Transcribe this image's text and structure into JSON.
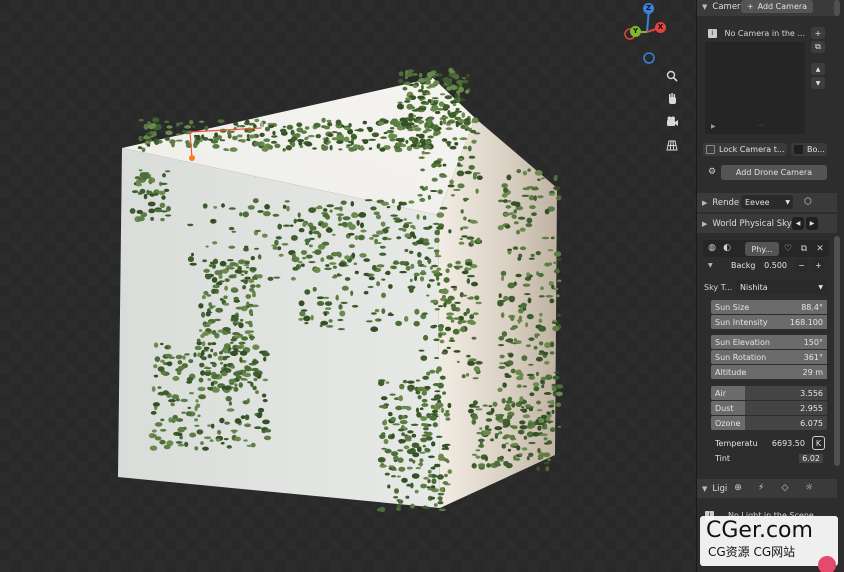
{
  "viewport": {
    "gizmo": {
      "x": "X",
      "y": "Y",
      "z": "Z"
    },
    "nav_icons": [
      "zoom-icon",
      "hand-pan-icon",
      "camera-view-icon",
      "grid-projection-icon"
    ],
    "colors": {
      "axis_x": "#e0443e",
      "axis_y": "#7fb92f",
      "axis_z": "#3b81e0",
      "ivy": "#4a6b35",
      "cube": "#e4e7e4"
    }
  },
  "camera_panel": {
    "header": "Camer",
    "add_camera": "Add Camera",
    "list_item": "No Camera in the ...",
    "lock_camera": "Lock Camera t...",
    "bo": "Bo...",
    "add_drone": "Add Drone Camera"
  },
  "render_panel": {
    "header": "Rende",
    "engine": "Eevee"
  },
  "world_panel": {
    "header": "World Physical Sky",
    "world_name": "Phy...",
    "background_label": "Backg",
    "background_value": "0.500",
    "sky_type_label": "Sky T...",
    "sky_type_value": "Nishita",
    "sun_size_label": "Sun Size",
    "sun_size_value": "88.4°",
    "sun_intensity_label": "Sun Intensity",
    "sun_intensity_value": "168.100",
    "sun_elevation_label": "Sun Elevation",
    "sun_elevation_value": "150°",
    "sun_rotation_label": "Sun Rotation",
    "sun_rotation_value": "361°",
    "altitude_label": "Altitude",
    "altitude_value": "29 m",
    "air_label": "Air",
    "air_value": "3.556",
    "dust_label": "Dust",
    "dust_value": "2.955",
    "ozone_label": "Ozone",
    "ozone_value": "6.075",
    "temperature_label": "Temperatu",
    "temperature_value": "6693.50",
    "temperature_unit": "K",
    "tint_label": "Tint",
    "tint_value": "6.02"
  },
  "light_panel": {
    "header": "Ligi",
    "list_item": "No Light in the Scene"
  },
  "watermark": {
    "brand": "CGer.com",
    "sub": "CG资源 CG网站"
  }
}
